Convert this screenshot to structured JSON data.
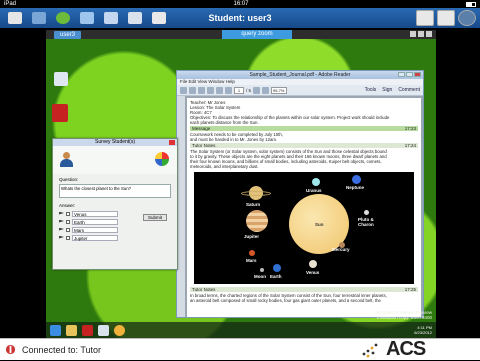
{
  "status_bar": {
    "carrier": "iPad",
    "time": "16:07"
  },
  "top_bar": {
    "title": "Student: user3"
  },
  "remote": {
    "tabs": {
      "left": "user3",
      "center": "query zoom"
    },
    "acrobat": {
      "title": "Sample_Student_Journal.pdf - Adobe Reader",
      "menu": "File  Edit  View  Window  Help",
      "page": "1",
      "page_total": "/ 5",
      "zoom": "95.7%",
      "links": {
        "tools": "Tools",
        "sign": "Sign",
        "comment": "Comment"
      },
      "header_lines": [
        "Teacher: Mr Jones",
        "Lesson: The Solar System",
        "Room: 4C7",
        "Objectives: To discuss the relationship of the planets within our solar system. Project work should include",
        "each planets distance from the Sun."
      ],
      "message_bar": {
        "label": "Message",
        "time": "17:23"
      },
      "message_lines": [
        "Coursework needs to be completed by July 10th,",
        "and must be handed in to Mr. Jones by 12am."
      ],
      "tutor_bar_1": {
        "label": "Tutor Notes",
        "time": "17:24"
      },
      "tutor_text_1": [
        "The Solar System (or Solar system, solar system) consists of the Sun and those celestial objects bound",
        "to it by gravity. These objects are the eight planets and their 166 known moons, three dwarf planets and",
        "their four known moons, and billions of small bodies, including asteroids, Kuiper belt objects, comets,",
        "meteoroids, and interplanetary dust."
      ],
      "planets": [
        "Uranus",
        "Neptune",
        "Saturn",
        "Sun",
        "Pluto & Charon",
        "Jupiter",
        "Mercury",
        "Mars",
        "Earth",
        "Venus",
        "Moon"
      ],
      "tutor_bar_2": {
        "label": "Tutor Notes",
        "time": "17:25"
      },
      "tutor_text_2": [
        "In broad terms, the charted regions of the Solar System consist of the Sun, four terrestrial inner planets,",
        "an asteroid belt composed of small rocky bodies, four gas giant outer planets, and a second belt, the"
      ]
    },
    "dialog": {
      "title": "Survey Student(s)",
      "question_label": "Question:",
      "question": "Whats the closest planet to the Sun?",
      "answer_label": "Answer:",
      "options": [
        "Venus",
        "Earth",
        "Mars",
        "Jupiter"
      ],
      "submit": "Submit"
    },
    "watermark": [
      "Windows 8 Release Preview",
      "Evaluation copy. Build 8400"
    ],
    "clock": [
      "4:11 PM",
      "6/23/2012"
    ]
  },
  "bottom_bar": {
    "status": "Connected to: Tutor",
    "logo": "ACS"
  },
  "colors": {
    "top_bar": "#1f5ca0",
    "accent_green": "#7ed321"
  }
}
